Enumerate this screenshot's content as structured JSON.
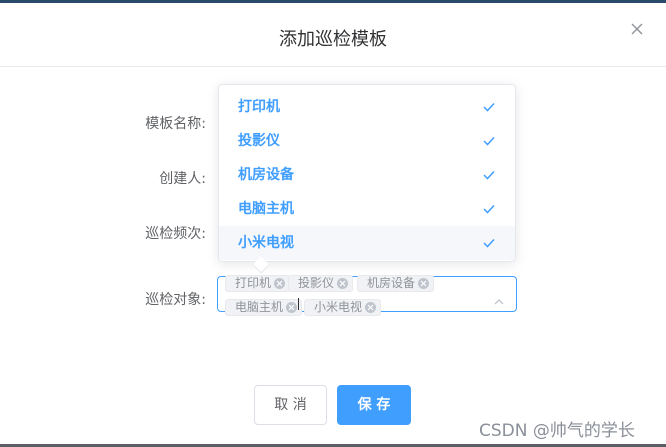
{
  "dialog": {
    "title": "添加巡检模板",
    "close_icon": "close-icon"
  },
  "form": {
    "labels": {
      "template_name": "模板名称:",
      "creator": "创建人:",
      "frequency": "巡检频次:",
      "targets": "巡检对象:"
    },
    "targets_selected": [
      {
        "label": "打印机"
      },
      {
        "label": "投影仪"
      },
      {
        "label": "机房设备"
      },
      {
        "label": "电脑主机"
      },
      {
        "label": "小米电视"
      }
    ]
  },
  "dropdown": {
    "options": [
      {
        "label": "打印机",
        "selected": true
      },
      {
        "label": "投影仪",
        "selected": true
      },
      {
        "label": "机房设备",
        "selected": true
      },
      {
        "label": "电脑主机",
        "selected": true
      },
      {
        "label": "小米电视",
        "selected": true
      }
    ]
  },
  "buttons": {
    "cancel": "取 消",
    "save": "保 存"
  },
  "watermark": "CSDN @帅气的学长",
  "colors": {
    "primary": "#409eff",
    "option_hover_bg": "#f5f7fa",
    "tag_bg": "#f0f2f5"
  }
}
